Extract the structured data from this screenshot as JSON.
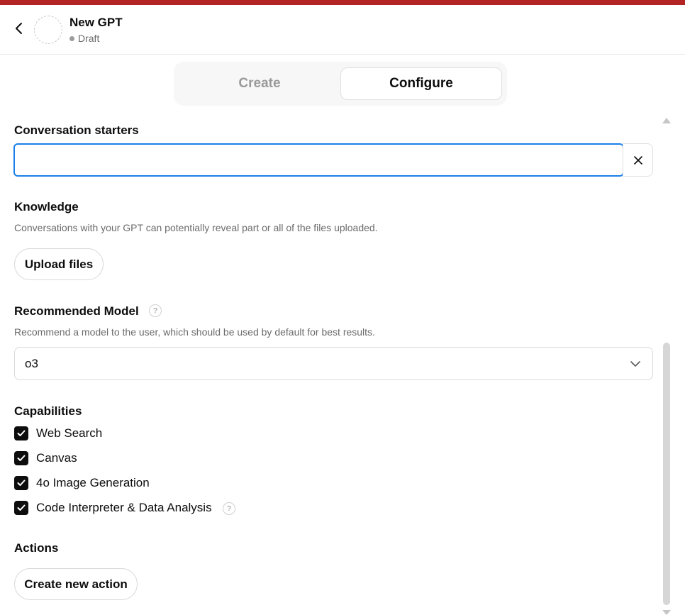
{
  "header": {
    "title": "New GPT",
    "status": "Draft"
  },
  "tabs": [
    {
      "label": "Create",
      "active": false
    },
    {
      "label": "Configure",
      "active": true
    }
  ],
  "conversation_starters": {
    "title": "Conversation starters",
    "value": ""
  },
  "knowledge": {
    "title": "Knowledge",
    "description": "Conversations with your GPT can potentially reveal part or all of the files uploaded.",
    "upload_label": "Upload files"
  },
  "recommended_model": {
    "title": "Recommended Model",
    "help": "?",
    "description": "Recommend a model to the user, which should be used by default for best results.",
    "selected": "o3"
  },
  "capabilities": {
    "title": "Capabilities",
    "items": [
      {
        "label": "Web Search",
        "checked": true
      },
      {
        "label": "Canvas",
        "checked": true
      },
      {
        "label": "4o Image Generation",
        "checked": true
      },
      {
        "label": "Code Interpreter & Data Analysis",
        "checked": true,
        "help": "?"
      }
    ]
  },
  "actions": {
    "title": "Actions",
    "create_label": "Create new action"
  },
  "colors": {
    "accent_bar": "#b32424",
    "focus_border": "#1a7fe8",
    "checkbox": "#0d0d0d"
  }
}
